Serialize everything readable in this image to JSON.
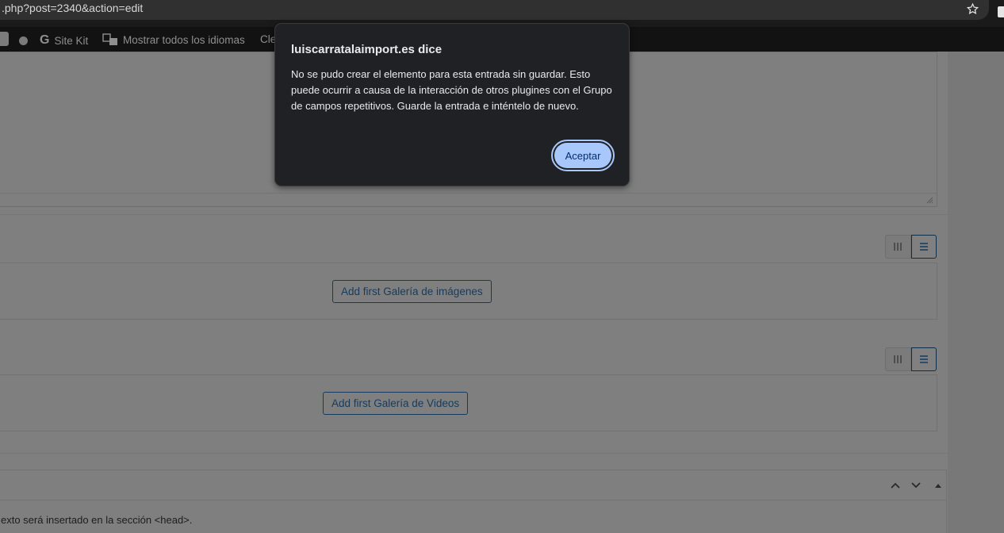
{
  "browser": {
    "url": ".php?post=2340&action=edit"
  },
  "adminbar": {
    "sitekit_label": "Site Kit",
    "languages_label": "Mostrar todos los idiomas",
    "truncated_item": "Cle"
  },
  "repeaters": [
    {
      "add_label": "Add first Galería de imágenes"
    },
    {
      "add_label": "Add first Galería de Videos"
    }
  ],
  "metabox": {
    "text": "exto será insertado en la sección <head>."
  },
  "dialog": {
    "title": "luiscarratalaimport.es dice",
    "message": "No se pudo crear el elemento para esta entrada sin guardar. Esto puede ocurrir a causa de la interacción de otros plugines con el Grupo de campos repetitivos. Guarde la entrada e inténtelo de nuevo.",
    "ok_label": "Aceptar",
    "accent_color": "#a8c7fa"
  }
}
